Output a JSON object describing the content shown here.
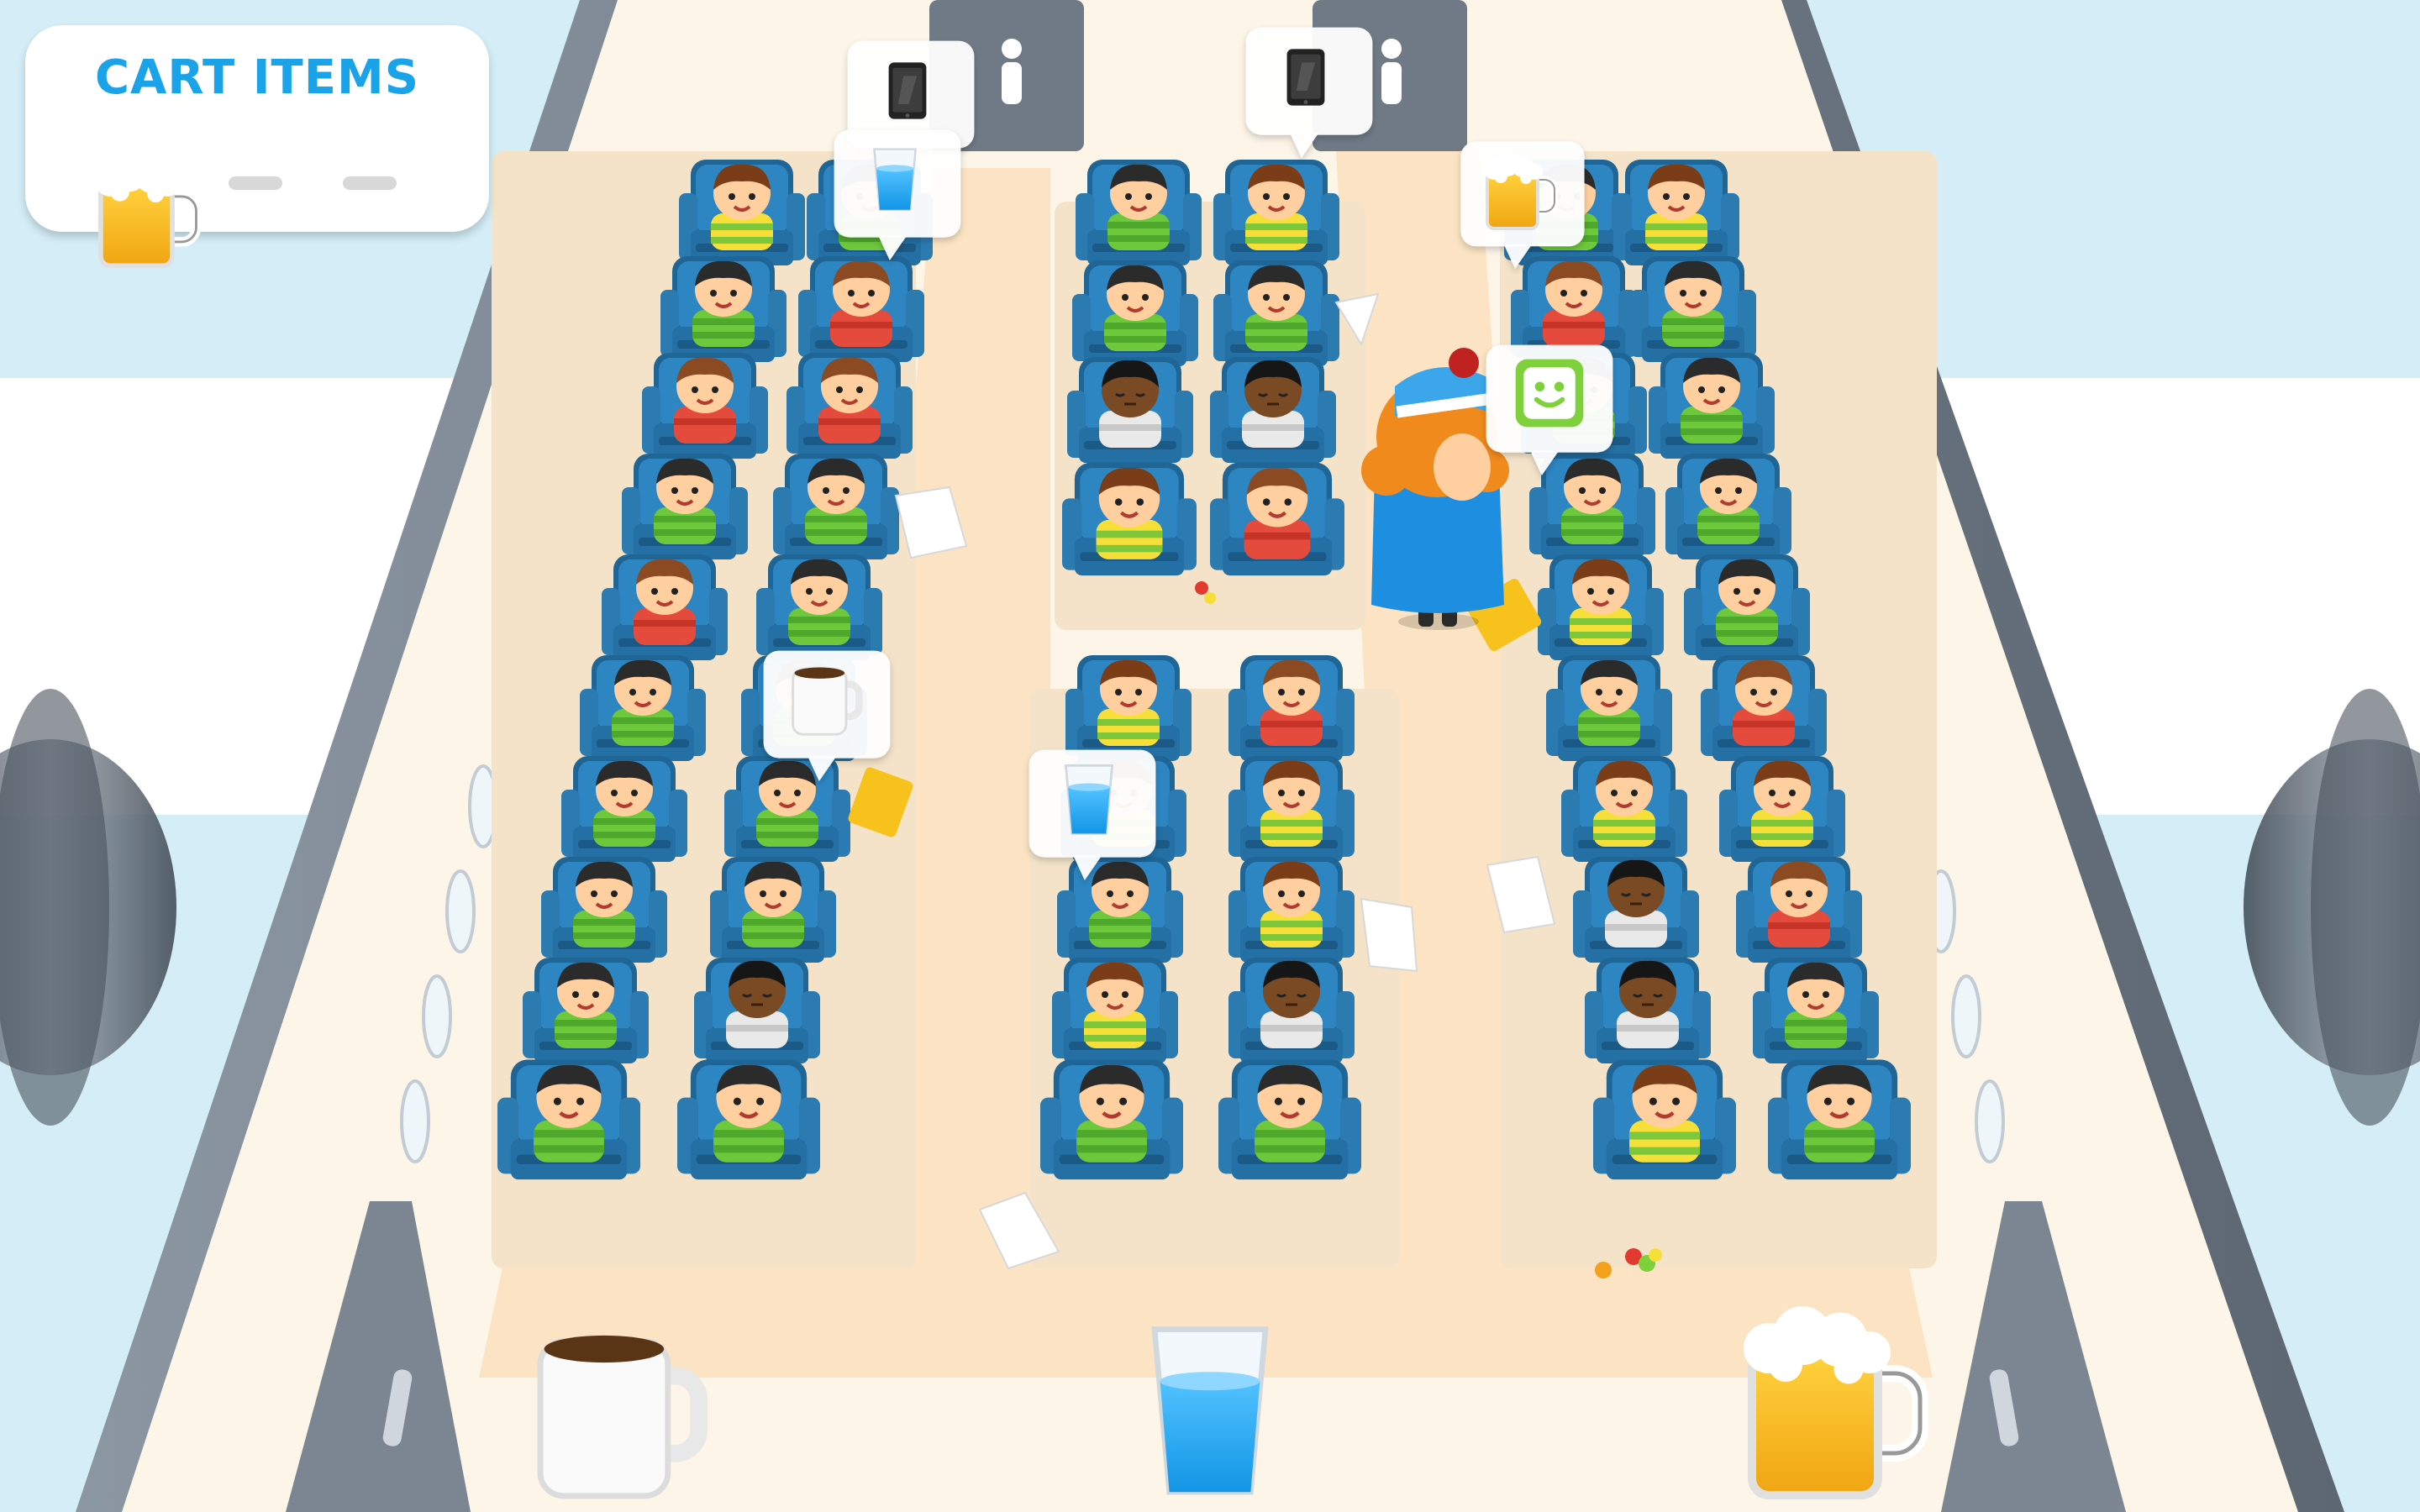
{
  "hud": {
    "title": "CART ITEMS",
    "slots": [
      {
        "item": "beer-mug-icon",
        "filled": true
      },
      {
        "item": "",
        "filled": false
      },
      {
        "item": "",
        "filled": false
      }
    ]
  },
  "tray": [
    {
      "item": "coffee-mug-icon"
    },
    {
      "item": "water-glass-icon"
    },
    {
      "item": "beer-mug-icon"
    }
  ],
  "requests": [
    {
      "item": "tablet-icon"
    },
    {
      "item": "tablet-icon"
    },
    {
      "item": "water-glass-icon"
    },
    {
      "item": "beer-mug-icon"
    },
    {
      "item": "smiley-toy-icon"
    },
    {
      "item": "coffee-mug-icon"
    },
    {
      "item": "water-glass-icon"
    }
  ],
  "colors": {
    "sky": "#d4edf7",
    "cabin_floor": "#fdf5e8",
    "aisle": "#fbe3c3",
    "seat": "#2d7fb5",
    "hull": "#6f7a86",
    "hud_title": "#1aa3e8",
    "attendant_uniform": "#1e8fe0",
    "attendant_hair": "#f08a1c"
  }
}
